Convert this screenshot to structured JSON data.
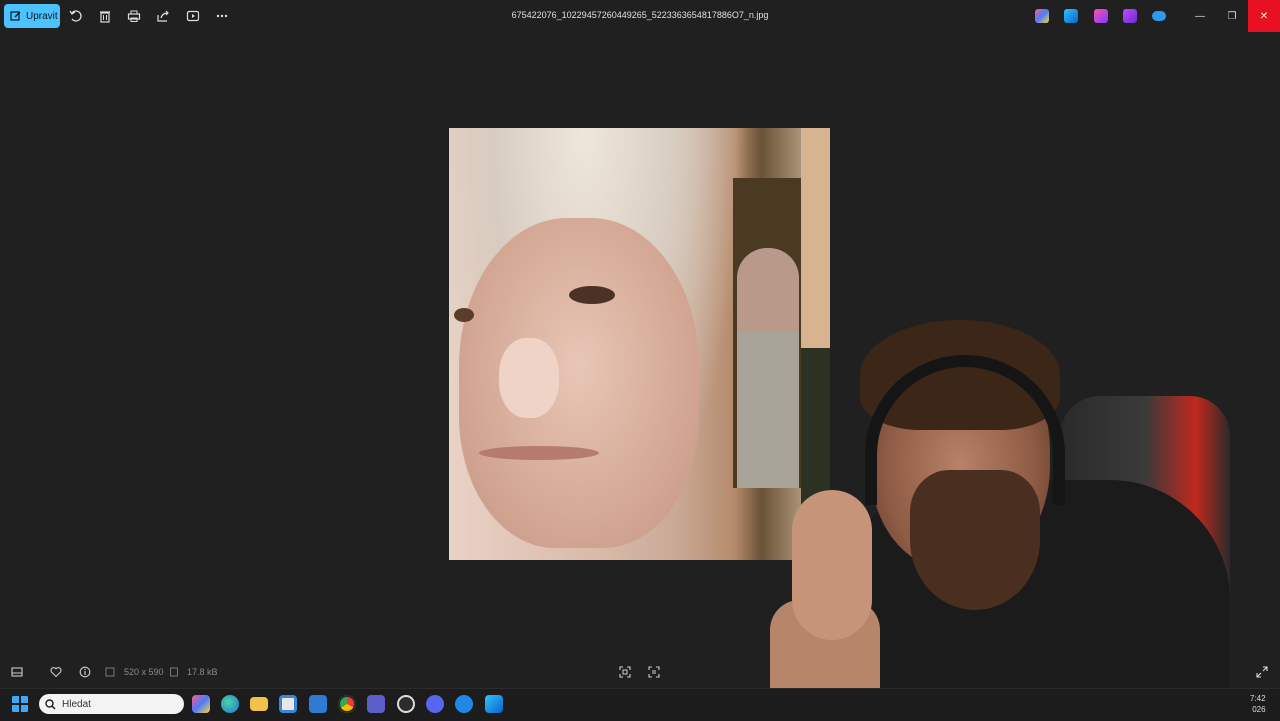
{
  "toolbar": {
    "edit_label": "Upravit",
    "filename": "675422076_10229457260449265_5223363654817886O7_n.jpg",
    "icons": [
      "rotate-icon",
      "delete-icon",
      "print-icon",
      "share-icon",
      "slideshow-icon",
      "more-icon"
    ]
  },
  "window": {
    "minimize": "—",
    "restore": "❐",
    "close": "✕"
  },
  "info": {
    "dimensions": "520 x 590",
    "filesize": "17.8 kB"
  },
  "taskbar": {
    "search_placeholder": "Hledat",
    "clock_time": "7:42",
    "clock_date": "026"
  },
  "colors": {
    "accent": "#4cc2ff",
    "close": "#e81123",
    "background": "#202020"
  }
}
